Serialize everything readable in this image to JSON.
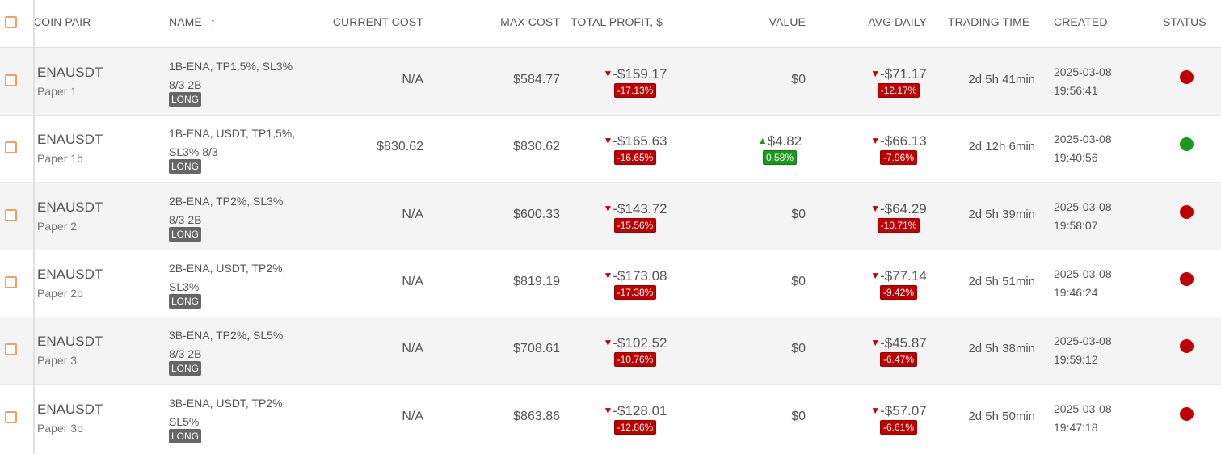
{
  "header": {
    "coin_pair": "COIN PAIR",
    "name": "NAME",
    "sort_arrow": "↑",
    "current_cost": "CURRENT COST",
    "max_cost": "MAX COST",
    "total_profit": "TOTAL PROFIT, $",
    "value": "VALUE",
    "avg_daily": "AVG DAILY",
    "trading_time": "TRADING TIME",
    "created": "CREATED",
    "status": "STATUS"
  },
  "colors": {
    "negative": "#c00000",
    "positive": "#1a9a1a",
    "checkbox": "#f0a060"
  },
  "rows": [
    {
      "pair": "ENAUSDT",
      "account": "Paper 1",
      "name": "1B-ENA, TP1,5%, SL3% 8/3 2B",
      "tag": "LONG",
      "current_cost": "N/A",
      "max_cost": "$584.77",
      "profit": "-$159.17",
      "profit_arrow": "▼",
      "profit_pct": "-17.13%",
      "value": "$0",
      "value_arrow": "",
      "value_pct": "",
      "avg": "-$71.17",
      "avg_arrow": "▼",
      "avg_pct": "-12.17%",
      "trading_time": "2d 5h 41min",
      "created_date": "2025-03-08",
      "created_time": "19:56:41",
      "status": "red"
    },
    {
      "pair": "ENAUSDT",
      "account": "Paper 1b",
      "name": "1B-ENA, USDT, TP1,5%, SL3% 8/3",
      "tag": "LONG",
      "current_cost": "$830.62",
      "max_cost": "$830.62",
      "profit": "-$165.63",
      "profit_arrow": "▼",
      "profit_pct": "-16.65%",
      "value": "$4.82",
      "value_arrow": "▲",
      "value_pct": "0.58%",
      "avg": "-$66.13",
      "avg_arrow": "▼",
      "avg_pct": "-7.96%",
      "trading_time": "2d 12h 6min",
      "created_date": "2025-03-08",
      "created_time": "19:40:56",
      "status": "green"
    },
    {
      "pair": "ENAUSDT",
      "account": "Paper 2",
      "name": "2B-ENA, TP2%, SL3% 8/3 2B",
      "tag": "LONG",
      "current_cost": "N/A",
      "max_cost": "$600.33",
      "profit": "-$143.72",
      "profit_arrow": "▼",
      "profit_pct": "-15.56%",
      "value": "$0",
      "value_arrow": "",
      "value_pct": "",
      "avg": "-$64.29",
      "avg_arrow": "▼",
      "avg_pct": "-10.71%",
      "trading_time": "2d 5h 39min",
      "created_date": "2025-03-08",
      "created_time": "19:58:07",
      "status": "red"
    },
    {
      "pair": "ENAUSDT",
      "account": "Paper 2b",
      "name": "2B-ENA, USDT, TP2%, SL3%",
      "tag": "LONG",
      "current_cost": "N/A",
      "max_cost": "$819.19",
      "profit": "-$173.08",
      "profit_arrow": "▼",
      "profit_pct": "-17.38%",
      "value": "$0",
      "value_arrow": "",
      "value_pct": "",
      "avg": "-$77.14",
      "avg_arrow": "▼",
      "avg_pct": "-9.42%",
      "trading_time": "2d 5h 51min",
      "created_date": "2025-03-08",
      "created_time": "19:46:24",
      "status": "red"
    },
    {
      "pair": "ENAUSDT",
      "account": "Paper 3",
      "name": "3B-ENA, TP2%, SL5% 8/3 2B",
      "tag": "LONG",
      "current_cost": "N/A",
      "max_cost": "$708.61",
      "profit": "-$102.52",
      "profit_arrow": "▼",
      "profit_pct": "-10.76%",
      "value": "$0",
      "value_arrow": "",
      "value_pct": "",
      "avg": "-$45.87",
      "avg_arrow": "▼",
      "avg_pct": "-6.47%",
      "trading_time": "2d 5h 38min",
      "created_date": "2025-03-08",
      "created_time": "19:59:12",
      "status": "red"
    },
    {
      "pair": "ENAUSDT",
      "account": "Paper 3b",
      "name": "3B-ENA, USDT, TP2%, SL5%",
      "tag": "LONG",
      "current_cost": "N/A",
      "max_cost": "$863.86",
      "profit": "-$128.01",
      "profit_arrow": "▼",
      "profit_pct": "-12.86%",
      "value": "$0",
      "value_arrow": "",
      "value_pct": "",
      "avg": "-$57.07",
      "avg_arrow": "▼",
      "avg_pct": "-6.61%",
      "trading_time": "2d 5h 50min",
      "created_date": "2025-03-08",
      "created_time": "19:47:18",
      "status": "red"
    }
  ]
}
